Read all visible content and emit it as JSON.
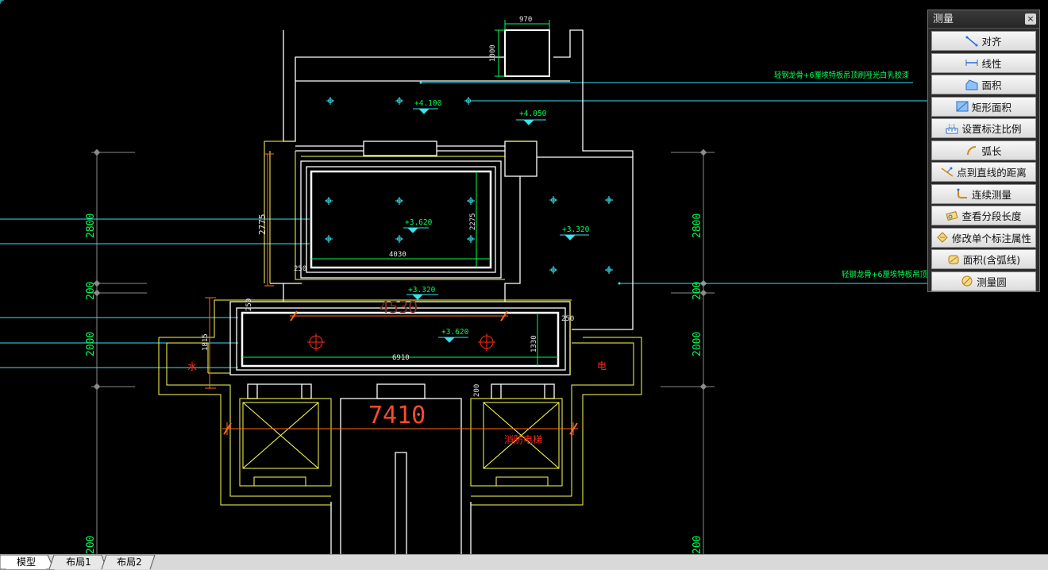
{
  "drawing": {
    "dims": {
      "d970": "970",
      "d1000": "1000",
      "d2775": "2775",
      "d2275": "2275",
      "d4030": "4030",
      "d250a": "250",
      "d250b": "250",
      "d250c": "250",
      "d4530": "4530",
      "d6910": "6910",
      "d1330": "1330",
      "d1815": "1815",
      "d7410": "7410",
      "d200": "200",
      "left2800": "2800",
      "left200": "200",
      "left2000": "2000",
      "left200b": "200",
      "right2800": "2800",
      "right200": "200",
      "right2000": "2000",
      "right200b": "200"
    },
    "levels": {
      "l4100": "+4.100",
      "l4050": "+4.050",
      "l3620a": "+3.620",
      "l3320a": "+3.320",
      "l3320b": "+3.320",
      "l3620b": "+3.620"
    },
    "notes": {
      "note_top": "轻钢龙骨+6厘埃特板吊顶刷哑光白乳胶漆",
      "note_right": "轻钢龙骨+6厘埃特板吊顶"
    },
    "labels": {
      "water": "水",
      "elec": "电",
      "fire_elevator": "消防电梯"
    }
  },
  "panel": {
    "title": "测量",
    "close": "×",
    "items": [
      {
        "label": "对齐",
        "icon": "align-icon"
      },
      {
        "label": "线性",
        "icon": "linear-icon"
      },
      {
        "label": "面积",
        "icon": "area-icon"
      },
      {
        "label": "矩形面积",
        "icon": "rect-area-icon"
      },
      {
        "label": "设置标注比例",
        "icon": "scale-icon"
      },
      {
        "label": "弧长",
        "icon": "arc-icon"
      },
      {
        "label": "点到直线的距离",
        "icon": "point-line-icon"
      },
      {
        "label": "连续测量",
        "icon": "continuous-icon"
      },
      {
        "label": "查看分段长度",
        "icon": "segment-icon"
      },
      {
        "label": "修改单个标注属性",
        "icon": "edit-dim-icon"
      },
      {
        "label": "面积(含弧线)",
        "icon": "arc-area-icon"
      },
      {
        "label": "测量圆",
        "icon": "circle-icon"
      }
    ]
  },
  "tabs": [
    "模型",
    "布局1",
    "布局2"
  ],
  "colors": {
    "bg": "#000000",
    "wall": "#ffffff",
    "yellow": "#ffff55",
    "dim_green": "#00ff55",
    "cyan": "#39e3ef",
    "red": "#ff2a1a",
    "orange": "#ff6a1a"
  }
}
